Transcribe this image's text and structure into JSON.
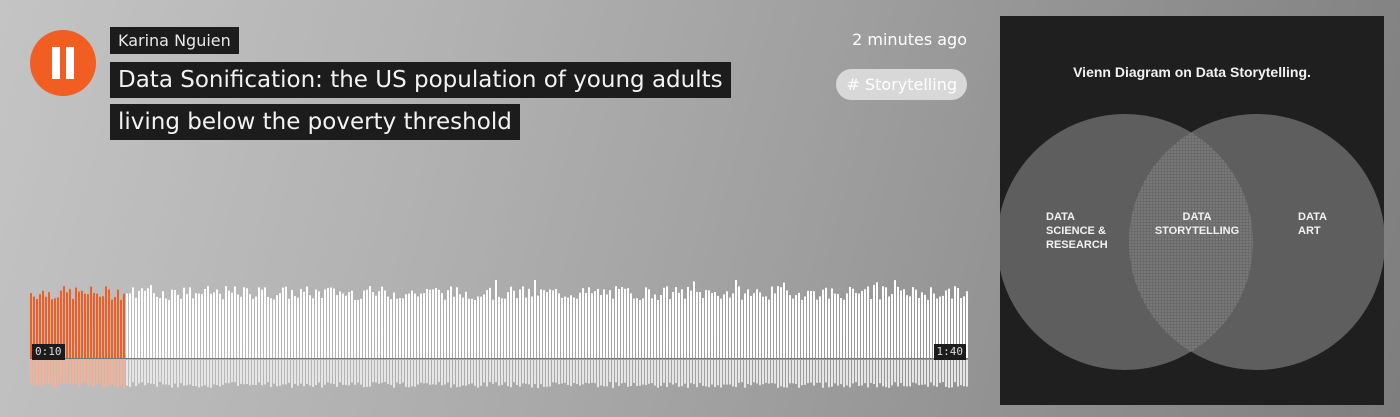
{
  "player": {
    "state": "playing",
    "accent_color": "#f25d22",
    "artist": "Karina Nguien",
    "title_lines": [
      "Data Sonification: the US population of young adults",
      "living below the poverty threshold"
    ],
    "posted": "2 minutes ago",
    "tag": "# Storytelling"
  },
  "waveform": {
    "current_time": "0:10",
    "total_time": "1:40",
    "progress": 0.1
  },
  "artwork": {
    "title": "Vienn Diagram on Data Storytelling.",
    "left_label": "DATA\nSCIENCE &\nRESEARCH",
    "middle_label": "DATA\nSTORYTELLING",
    "right_label": "DATA\nART"
  }
}
